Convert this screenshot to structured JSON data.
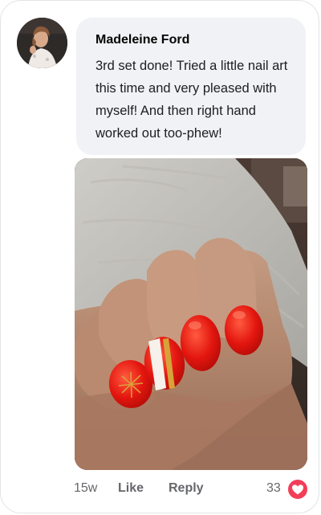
{
  "comment": {
    "author": "Madeleine Ford",
    "text": "3rd set done! Tried a little nail art this time and very pleased with myself! And then right hand worked out too-phew!",
    "age": "15w",
    "like_label": "Like",
    "reply_label": "Reply",
    "reaction_count": "33",
    "reaction_icon": "heart-icon"
  },
  "colors": {
    "bubble_bg": "#f0f2f5",
    "meta_text": "#65676b",
    "heart_red": "#f33e58",
    "nail_red": "#e3160f"
  }
}
